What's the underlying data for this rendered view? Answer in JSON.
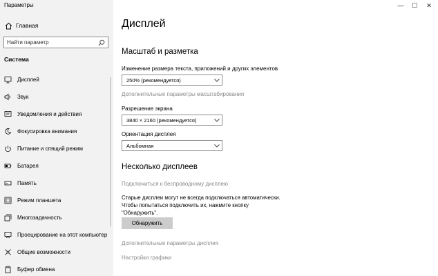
{
  "window": {
    "title": "Параметры",
    "controls": {
      "minimize": "—",
      "maximize": "☐",
      "close": "✕"
    }
  },
  "sidebar": {
    "home_label": "Главная",
    "search_placeholder": "Найти параметр",
    "section_label": "Система",
    "items": [
      {
        "label": "Дисплей",
        "icon": "display-icon"
      },
      {
        "label": "Звук",
        "icon": "sound-icon"
      },
      {
        "label": "Уведомления и действия",
        "icon": "notifications-icon"
      },
      {
        "label": "Фокусировка внимания",
        "icon": "focus-assist-icon"
      },
      {
        "label": "Питание и спящий режим",
        "icon": "power-icon"
      },
      {
        "label": "Батарея",
        "icon": "battery-icon"
      },
      {
        "label": "Память",
        "icon": "storage-icon"
      },
      {
        "label": "Режим планшета",
        "icon": "tablet-mode-icon"
      },
      {
        "label": "Многозадачность",
        "icon": "multitasking-icon"
      },
      {
        "label": "Проецирование на этот компьютер",
        "icon": "projecting-icon"
      },
      {
        "label": "Общие возможности",
        "icon": "shared-experiences-icon"
      },
      {
        "label": "Буфер обмена",
        "icon": "clipboard-icon"
      }
    ]
  },
  "main": {
    "title": "Дисплей",
    "scale_section": {
      "heading": "Масштаб и разметка",
      "size_label": "Изменение размера текста, приложений и других элементов",
      "size_value": "250% (рекомендуется)",
      "advanced_scaling_link": "Дополнительные параметры масштабирования",
      "resolution_label": "Разрешение экрана",
      "resolution_value": "3840 × 2160 (рекомендуется)",
      "orientation_label": "Ориентация дисплея",
      "orientation_value": "Альбомная"
    },
    "multi_section": {
      "heading": "Несколько дисплеев",
      "wireless_link": "Подключиться к беспроводному дисплею",
      "description_lines": [
        "Старые дисплеи могут не всегда подключаться автоматически.",
        "Чтобы попытаться подключить их, нажмите кнопку",
        "\"Обнаружить\"."
      ],
      "detect_button": "Обнаружить",
      "advanced_display_link": "Дополнительные параметры дисплея",
      "graphics_link": "Настройки графики"
    }
  }
}
